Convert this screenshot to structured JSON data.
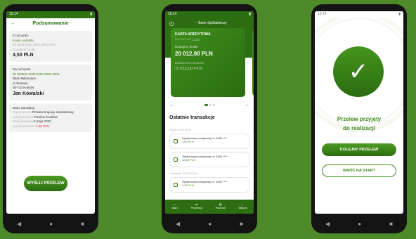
{
  "phone1": {
    "status_time": "15:14",
    "title": "Podsumowanie",
    "from_label": "Z rachunku",
    "from_account": "Konto osobiste",
    "from_account_number": "00 0000 0000 0000 0000 0000",
    "available_label": "Dostępne środki",
    "available_amount": "4,53 PLN",
    "to_label": "Na rachunek",
    "to_account_number": "00 000000 0000 0000 0000 0000",
    "recipient_lines": [
      "Bank Millennium",
      "ul.Testowa",
      "00-710 Kraków"
    ],
    "recipient_name": "Jan Kowalski",
    "details_label": "Dane transakcji",
    "details": [
      {
        "label": "Typ przelewu",
        "value": "Przelew krajowy standardowy"
      },
      {
        "label": "Tytuł przelewu",
        "value": "Przelew środków"
      },
      {
        "label": "Data przelewu",
        "value": "8 maja 2020"
      },
      {
        "label": "Kwota przelewu",
        "value": "1,00 PLN"
      }
    ],
    "send_button": "WYŚLIJ PRZELEW"
  },
  "phone2": {
    "status_time": "15:14",
    "logo_text": "Bank Spółdzielczy",
    "card": {
      "title": "KARTA KREDYTOWA",
      "number": "**** **** **** 1234",
      "balance_label": "Dostępne środki",
      "balance": "20 012,00 PLN",
      "debt_label": "Zadłużenie na karcie",
      "debt": "-5 012,00 PLN"
    },
    "recent_title": "Ostatnie transakcje",
    "groups": [
      {
        "date": "Środa, 6.05.2020",
        "items": [
          {
            "desc": "Spłata karty kredytowej nr: 3400 ****",
            "amount": "1,00 PLN"
          },
          {
            "desc": "Spłata karty kredytowej nr: 3400 ****",
            "amount": "10,62 PLN"
          }
        ]
      },
      {
        "date": "Czwartek, 30.04.2020",
        "items": [
          {
            "desc": "Spłata karty kredytowej nr: 3400 ****",
            "amount": "1,55 PLN"
          }
        ]
      }
    ],
    "nav": [
      "Start",
      "Przelewy",
      "Finanse",
      "Więcej"
    ]
  },
  "phone3": {
    "status_time": "15:14",
    "message_line1": "Przelew przyjęty",
    "message_line2": "do realizacji",
    "next_button": "KOLEJNY PRZELEW",
    "back_button": "WRÓĆ NA START"
  },
  "colors": {
    "brand": "#2f7212",
    "background": "#4f8a2a",
    "accent_red": "#d33333"
  }
}
